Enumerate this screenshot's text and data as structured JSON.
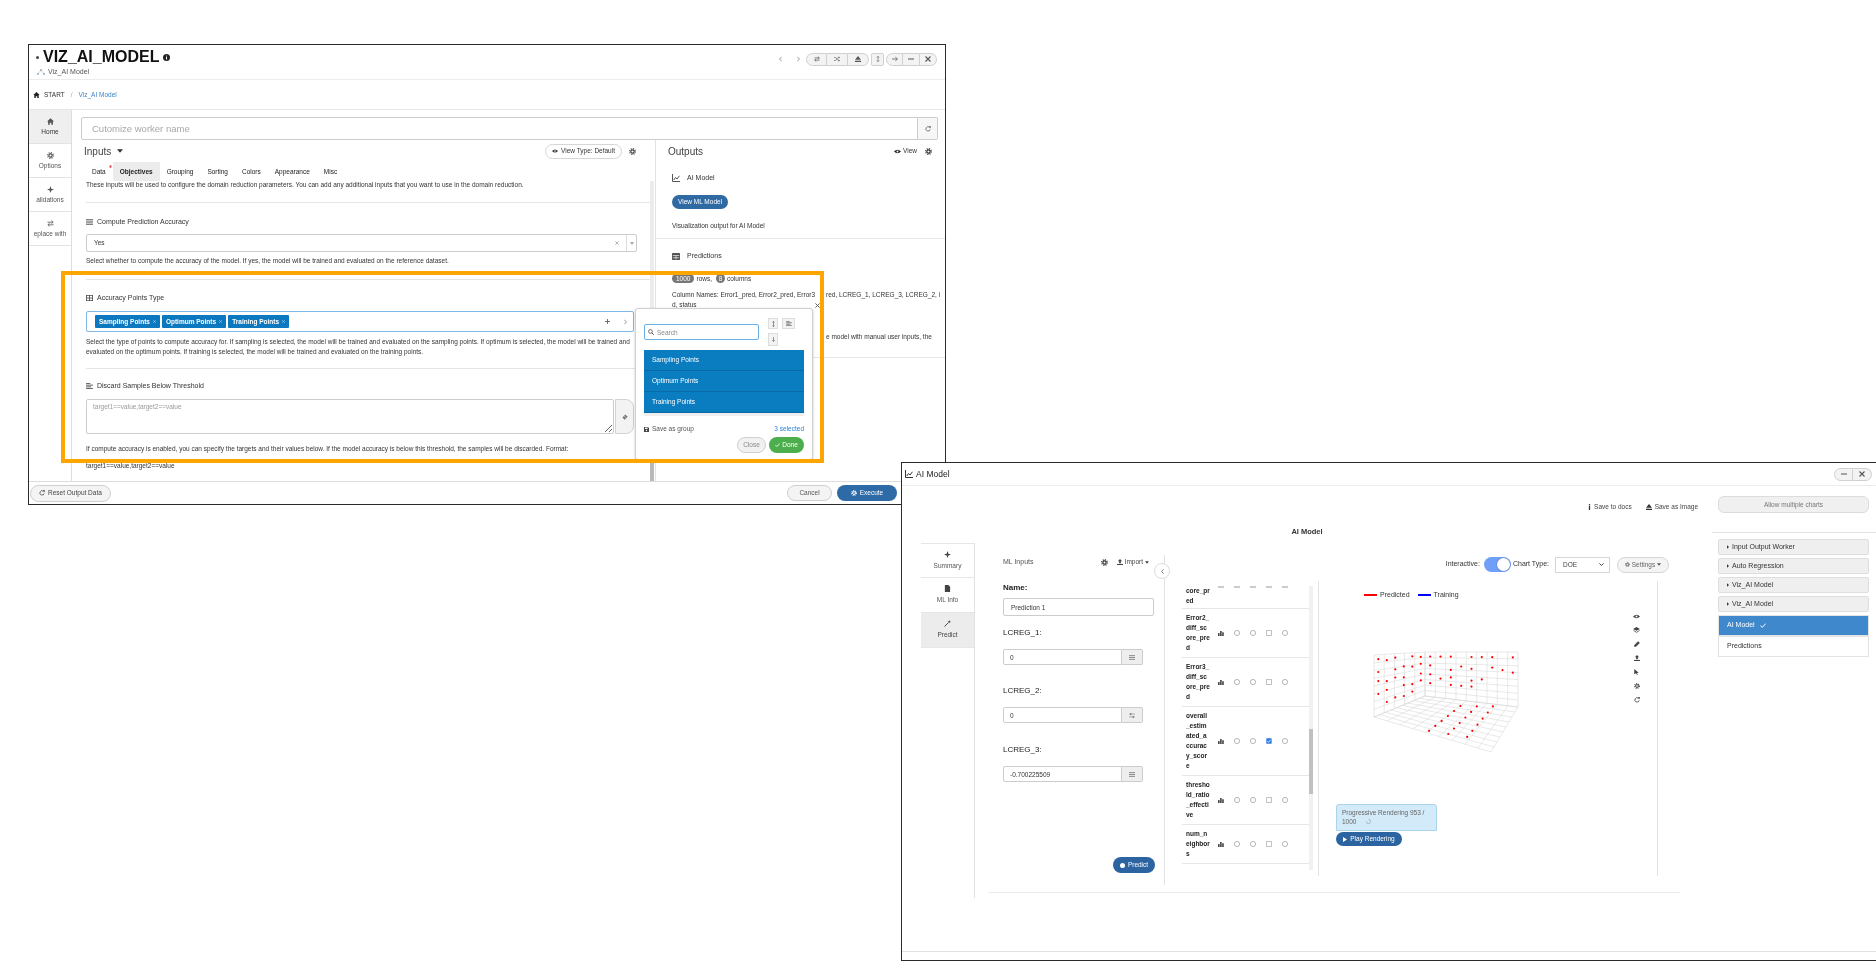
{
  "main_window": {
    "title": "VIZ_AI_MODEL",
    "subtitle": "Viz_AI Model",
    "breadcrumb": {
      "home": "START",
      "separator": "/",
      "current": "Viz_AI Model"
    },
    "sidebar": [
      {
        "label": "Home",
        "selected": true
      },
      {
        "label": "Options",
        "selected": false
      },
      {
        "label": "alidations",
        "selected": false
      },
      {
        "label": "eplace with",
        "selected": false
      }
    ],
    "worker_name": {
      "placeholder": "Cutomize worker name"
    },
    "inputs": {
      "title": "Inputs",
      "view_type": "View Type: Default",
      "tabs": [
        {
          "label": "Data",
          "selected": false,
          "required": true
        },
        {
          "label": "Objectives",
          "selected": true,
          "required": false
        },
        {
          "label": "Grouping",
          "selected": false,
          "required": false
        },
        {
          "label": "Sorting",
          "selected": false,
          "required": false
        },
        {
          "label": "Colors",
          "selected": false,
          "required": false
        },
        {
          "label": "Appearance",
          "selected": false,
          "required": false
        },
        {
          "label": "Misc",
          "selected": false,
          "required": false
        }
      ],
      "description": "These inputs will be used to configure the domain reduction parameters. You can add any additional inputs that you want to use in the domain reduction.",
      "fields": [
        {
          "kind": "select",
          "label": "Compute Prediction Accuracy",
          "value": "Yes",
          "help": "Select whether to compute the accuracy of the model. If yes, the model will be trained and evaluated on the reference dataset."
        },
        {
          "kind": "multiselect",
          "label": "Accuracy Points Type",
          "tags": [
            "Sampling Points",
            "Optimum Points",
            "Training Points"
          ],
          "help": "Select the type of points to compute accuracy for. If sampling is selected, the model will be trained and evaluated on the sampling points. If optimum is selected, the model will be trained and evaluated on the optimum points. If training is selected, the model will be trained and evaluated on the training points."
        },
        {
          "kind": "textarea",
          "label": "Discard Samples Below Threshold",
          "placeholder": "target1==value,target2==value",
          "help": "If compute accuracy is enabled, you can specify the targets and their values below. If the model accuracy is below this threshold, the samples will be discarded. Format: target1==value,target2==value"
        }
      ]
    },
    "outputs": {
      "title": "Outputs",
      "view": "View",
      "items": [
        {
          "kind": "chart",
          "title": "AI Model",
          "button": "View ML Model",
          "description": "Visualization output for AI Model"
        },
        {
          "kind": "table",
          "title": "Predictions",
          "rows": "1000",
          "rows_label": "rows,",
          "columns": "8",
          "columns_label": "columns",
          "column_names": [
            [
              "Column Names: Error1_pred, Error2_pred, Error3",
              "red, LCREG_1, LCREG_3, LCREG_2, i"
            ],
            [
              "d, status"
            ]
          ],
          "note": "e model with manual user inputs, the"
        }
      ]
    },
    "dropdown": {
      "search_placeholder": "Search",
      "options": [
        {
          "label": "Sampling Points",
          "selected": true
        },
        {
          "label": "Optimum Points",
          "selected": true
        },
        {
          "label": "Training Points",
          "selected": true
        }
      ],
      "save_group": "Save as group",
      "count": "3 selected",
      "close": "Close",
      "done": "Done"
    },
    "footer": {
      "reset": "Reset Output Data",
      "cancel": "Cancel",
      "execute": "Execute"
    }
  },
  "chart_window": {
    "title": "AI Model",
    "allow_multiple": "Allow multiple charts",
    "actions": [
      "Save to docs",
      "Save as Image"
    ],
    "chart_title": "AI Model",
    "tabs": [
      {
        "label": "Summary",
        "selected": false
      },
      {
        "label": "ML Info",
        "selected": false
      },
      {
        "label": "Predict",
        "selected": true
      }
    ],
    "ml_inputs": {
      "title": "ML Inputs",
      "import": "Import",
      "name_label": "Name:",
      "name_value": "Prediction 1",
      "params": [
        {
          "label": "LCREG_1:",
          "value": "0"
        },
        {
          "label": "LCREG_2:",
          "value": "0"
        },
        {
          "label": "LCREG_3:",
          "value": "-0.700225509"
        }
      ],
      "predict": "Predict"
    },
    "output_rows": [
      {
        "name": "core_pred",
        "clipped": true
      },
      {
        "name": "Error2_diff_score_pred",
        "clipped": false,
        "controls": [
          {
            "kind": "radio",
            "checked": false
          },
          {
            "kind": "radio",
            "checked": false
          },
          {
            "kind": "checkbox",
            "checked": false
          },
          {
            "kind": "radio",
            "checked": false
          }
        ]
      },
      {
        "name": "Error3_diff_score_pred",
        "clipped": false,
        "controls": [
          {
            "kind": "radio",
            "checked": false
          },
          {
            "kind": "radio",
            "checked": false
          },
          {
            "kind": "checkbox",
            "checked": false
          },
          {
            "kind": "radio",
            "checked": false
          }
        ]
      },
      {
        "name": "overall_estimated_accuracy_score",
        "clipped": false,
        "controls": [
          {
            "kind": "radio",
            "checked": false
          },
          {
            "kind": "radio",
            "checked": false
          },
          {
            "kind": "checkbox",
            "checked": true
          },
          {
            "kind": "radio",
            "checked": false
          }
        ]
      },
      {
        "name": "threshold_ratio_effective",
        "clipped": false,
        "controls": [
          {
            "kind": "radio",
            "checked": false
          },
          {
            "kind": "radio",
            "checked": false
          },
          {
            "kind": "checkbox",
            "checked": false
          },
          {
            "kind": "radio",
            "checked": false
          }
        ]
      },
      {
        "name": "num_neighbors",
        "clipped": false,
        "controls": [
          {
            "kind": "radio",
            "checked": false
          },
          {
            "kind": "radio",
            "checked": false
          },
          {
            "kind": "checkbox",
            "checked": false
          },
          {
            "kind": "radio",
            "checked": false
          }
        ]
      }
    ],
    "interactive": {
      "label": "Interactive:",
      "on": true
    },
    "chart_type": {
      "label": "Chart Type:",
      "value": "DOE"
    },
    "settings": "Settings",
    "legend": [
      {
        "label": "Predicted",
        "color": "#ff0000"
      },
      {
        "label": "Training",
        "color": "#0000ff"
      }
    ],
    "progress": {
      "text": "Progressive Rendering 953 /",
      "count": "1000"
    },
    "play": "Play Rendering",
    "tree": [
      {
        "label": "Input Output Worker",
        "kind": "group",
        "selected": false
      },
      {
        "label": "Auto Regression",
        "kind": "group",
        "selected": false
      },
      {
        "label": "Viz_AI Model",
        "kind": "group",
        "selected": false
      },
      {
        "label": "Viz_AI Model",
        "kind": "group",
        "selected": false
      },
      {
        "label": "AI Model",
        "kind": "item",
        "selected": true
      },
      {
        "label": "Predictions",
        "kind": "item",
        "selected": false
      }
    ]
  }
}
